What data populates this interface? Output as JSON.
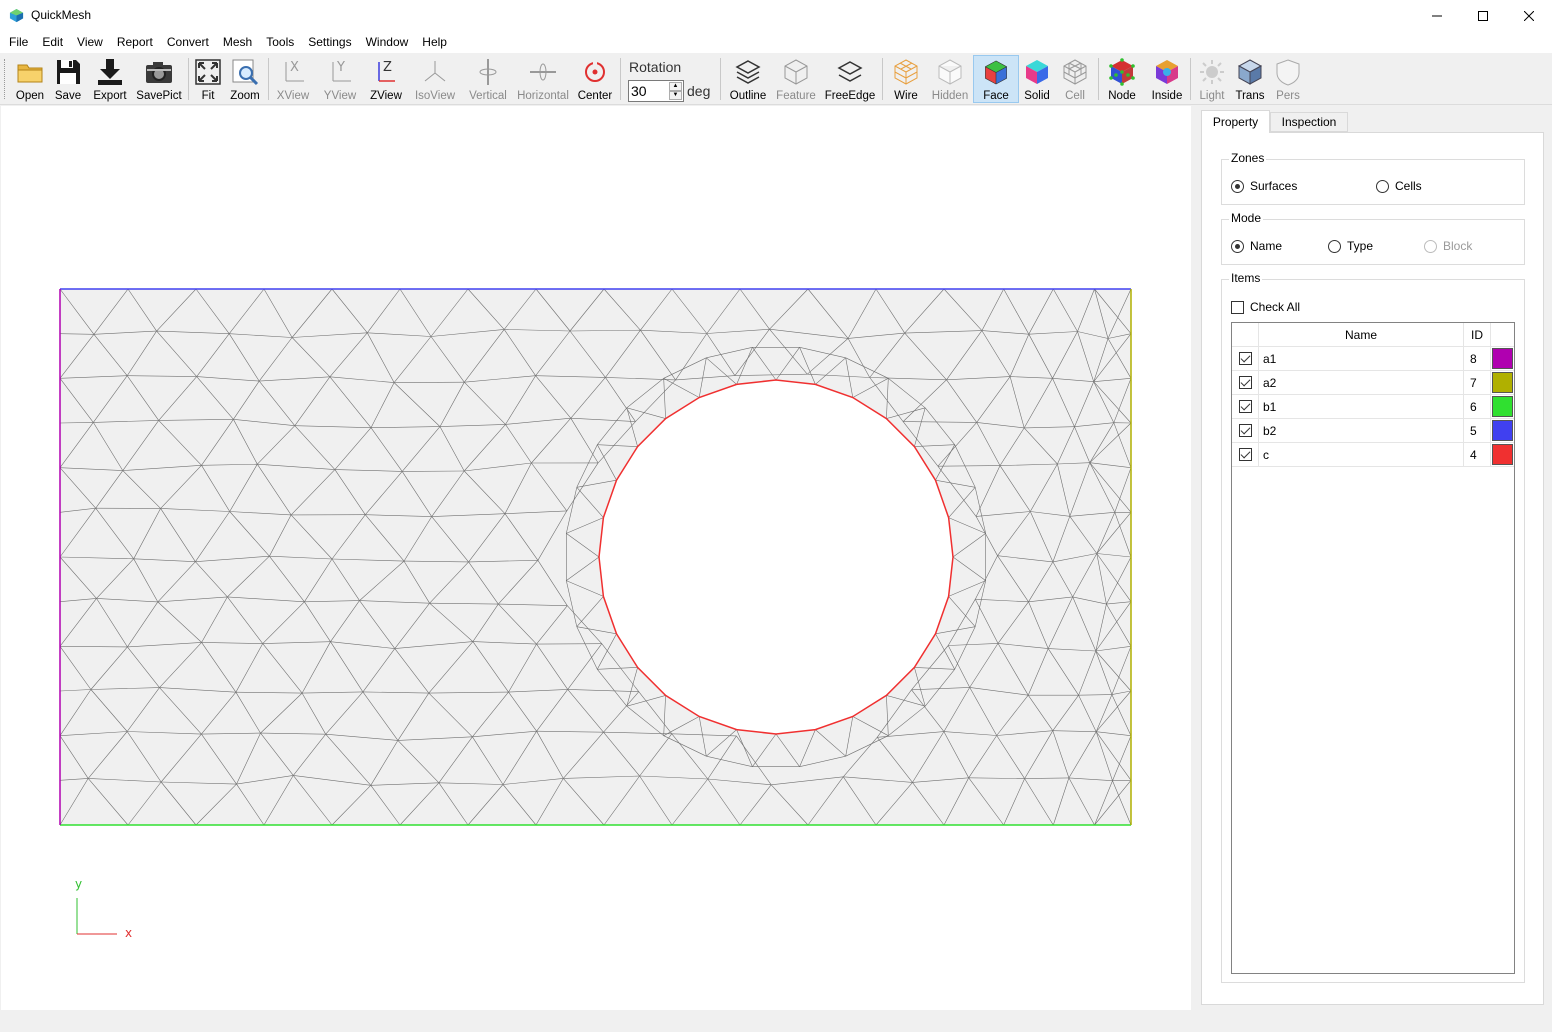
{
  "window": {
    "title": "QuickMesh",
    "minimize_icon": "minimize-icon",
    "maximize_icon": "maximize-icon",
    "close_icon": "close-icon"
  },
  "menu": [
    "File",
    "Edit",
    "View",
    "Report",
    "Convert",
    "Mesh",
    "Tools",
    "Settings",
    "Window",
    "Help"
  ],
  "toolbar": {
    "open": "Open",
    "save": "Save",
    "export": "Export",
    "savepict": "SavePict",
    "fit": "Fit",
    "zoom": "Zoom",
    "xview": "XView",
    "yview": "YView",
    "zview": "ZView",
    "isoview": "IsoView",
    "vertical": "Vertical",
    "horizontal": "Horizontal",
    "center": "Center",
    "rotation_label": "Rotation",
    "rotation_value": "30",
    "rotation_unit": "deg",
    "outline": "Outline",
    "feature": "Feature",
    "freeedge": "FreeEdge",
    "wire": "Wire",
    "hidden": "Hidden",
    "face": "Face",
    "solid": "Solid",
    "cell": "Cell",
    "node": "Node",
    "inside": "Inside",
    "light": "Light",
    "trans": "Trans",
    "pers": "Pers"
  },
  "viewport": {
    "axis_y": "y",
    "axis_x": "x",
    "boundary_colors": {
      "a1": "#b000b0",
      "a2": "#b0b000",
      "b1": "#30e030",
      "b2": "#4040f0",
      "c": "#f03030"
    },
    "mesh_fill": "#f0f0f0",
    "mesh_line": "#707070"
  },
  "panel": {
    "tabs": [
      "Property",
      "Inspection"
    ],
    "zones": {
      "title": "Zones",
      "options": [
        "Surfaces",
        "Cells"
      ],
      "selected": "Surfaces"
    },
    "mode": {
      "title": "Mode",
      "options": [
        "Name",
        "Type",
        "Block"
      ],
      "selected": "Name",
      "disabled": [
        "Block"
      ]
    },
    "items": {
      "title": "Items",
      "check_all": "Check All",
      "columns": [
        "Name",
        "ID"
      ],
      "rows": [
        {
          "name": "a1",
          "id": "8",
          "color": "#b000b0",
          "checked": true
        },
        {
          "name": "a2",
          "id": "7",
          "color": "#b0b000",
          "checked": true
        },
        {
          "name": "b1",
          "id": "6",
          "color": "#30e030",
          "checked": true
        },
        {
          "name": "b2",
          "id": "5",
          "color": "#4040f0",
          "checked": true
        },
        {
          "name": "c",
          "id": "4",
          "color": "#f03030",
          "checked": true
        }
      ]
    }
  }
}
